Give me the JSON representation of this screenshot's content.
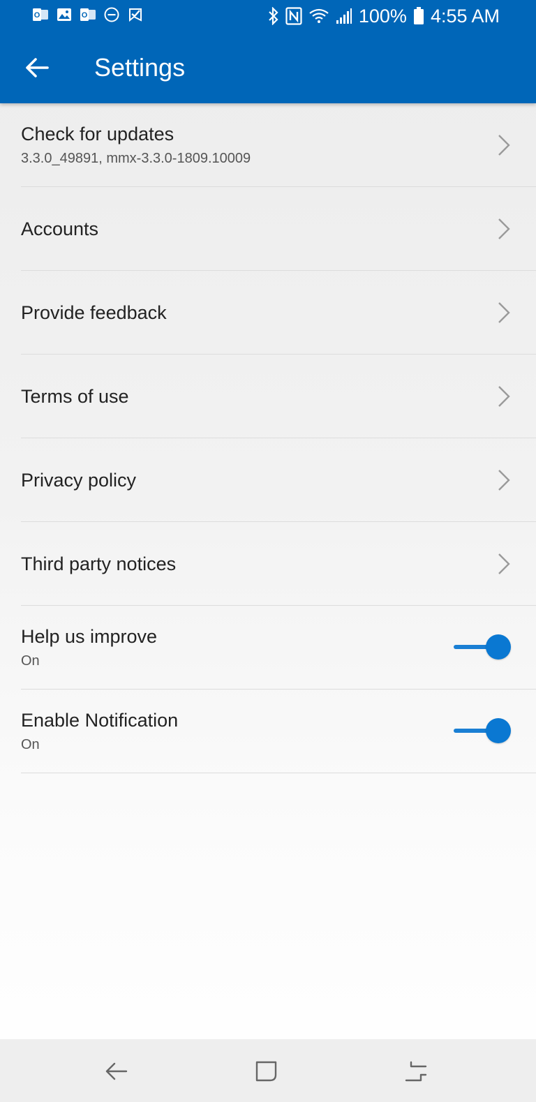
{
  "status_bar": {
    "notification_icons": [
      "outlook-icon",
      "gallery-icon",
      "outlook-icon",
      "do-not-disturb-icon",
      "checkmark-flag-icon"
    ],
    "battery": "100%",
    "time": "4:55 AM"
  },
  "app_bar": {
    "title": "Settings",
    "color": "#0066b8"
  },
  "settings": [
    {
      "title": "Check for updates",
      "subtitle": "3.3.0_49891, mmx-3.3.0-1809.10009",
      "control": "chevron"
    },
    {
      "title": "Accounts",
      "control": "chevron"
    },
    {
      "title": "Provide feedback",
      "control": "chevron"
    },
    {
      "title": "Terms of use",
      "control": "chevron"
    },
    {
      "title": "Privacy policy",
      "control": "chevron"
    },
    {
      "title": "Third party notices",
      "control": "chevron"
    },
    {
      "title": "Help us improve",
      "subtitle": "On",
      "control": "toggle",
      "value": true
    },
    {
      "title": "Enable Notification",
      "subtitle": "On",
      "control": "toggle",
      "value": true
    }
  ],
  "nav_bar": {
    "buttons": [
      "back-nav-icon",
      "home-nav-icon",
      "recents-nav-icon"
    ]
  }
}
